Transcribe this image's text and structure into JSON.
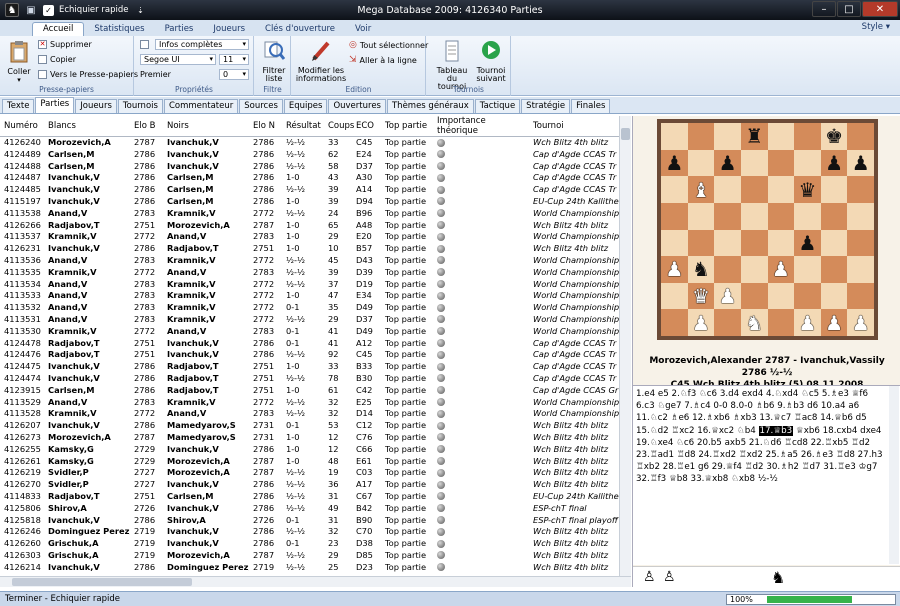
{
  "window": {
    "title": "Mega Database 2009:  4126340 Parties",
    "quick_access_label": "Echiquier rapide",
    "controls": [
      "–",
      "□",
      "✕"
    ]
  },
  "ribbon_tabs": [
    "Accueil",
    "Statistiques",
    "Parties",
    "Joueurs",
    "Clés d'ouverture",
    "Voir"
  ],
  "style_menu": "Style",
  "ribbon": {
    "clipboard": {
      "coller": "Coller",
      "supprimer": "Supprimer",
      "copier": "Copier",
      "vers": "Vers le Presse-papiers",
      "label": "Presse-papiers"
    },
    "props": {
      "infos": "Infos complètes",
      "font": "Segoe UI",
      "size": "11",
      "premier": "Premier",
      "premier_val": "0",
      "label": "Propriétés"
    },
    "filtre": {
      "btn1": "Filtrer",
      "btn2": "liste",
      "label": "Filtre"
    },
    "edition": {
      "modifier1": "Modifier les",
      "modifier2": "informations",
      "tout": "Tout sélectionner",
      "aller": "Aller à la ligne",
      "label": "Edition"
    },
    "tournois": {
      "tableau1": "Tableau",
      "tableau2": "du tournoi",
      "suivant1": "Tournoi",
      "suivant2": "suivant",
      "label": "Tournois"
    }
  },
  "doc_tabs": [
    "Texte",
    "Parties",
    "Joueurs",
    "Tournois",
    "Commentateur",
    "Sources",
    "Equipes",
    "Ouvertures",
    "Thèmes généraux",
    "Tactique",
    "Stratégie",
    "Finales"
  ],
  "columns": [
    "Numéro",
    "Blancs",
    "Elo B",
    "Noirs",
    "Elo N",
    "Résultat",
    "Coups",
    "ECO",
    "Top partie",
    "Importance théorique",
    "Tournoi"
  ],
  "rows": [
    [
      "4126240",
      "Morozevich,A",
      "2787",
      "Ivanchuk,V",
      "2786",
      "½-½",
      "33",
      "C45",
      "Top partie",
      "Wch Blitz 4th blitz"
    ],
    [
      "4124489",
      "Carlsen,M",
      "2786",
      "Ivanchuk,V",
      "2786",
      "½-½",
      "62",
      "E24",
      "Top partie",
      "Cap d'Agde CCAS Tr"
    ],
    [
      "4124488",
      "Carlsen,M",
      "2786",
      "Ivanchuk,V",
      "2786",
      "½-½",
      "58",
      "D37",
      "Top partie",
      "Cap d'Agde CCAS Tr"
    ],
    [
      "4124487",
      "Ivanchuk,V",
      "2786",
      "Carlsen,M",
      "2786",
      "1-0",
      "43",
      "A30",
      "Top partie",
      "Cap d'Agde CCAS Tr"
    ],
    [
      "4124485",
      "Ivanchuk,V",
      "2786",
      "Carlsen,M",
      "2786",
      "½-½",
      "39",
      "A14",
      "Top partie",
      "Cap d'Agde CCAS Tr"
    ],
    [
      "4115197",
      "Ivanchuk,V",
      "2786",
      "Carlsen,M",
      "2786",
      "1-0",
      "39",
      "D94",
      "Top partie",
      "EU-Cup 24th Kallithe"
    ],
    [
      "4113538",
      "Anand,V",
      "2783",
      "Kramnik,V",
      "2772",
      "½-½",
      "24",
      "B96",
      "Top partie",
      "World Championship"
    ],
    [
      "4126266",
      "Radjabov,T",
      "2751",
      "Morozevich,A",
      "2787",
      "1-0",
      "65",
      "A48",
      "Top partie",
      "Wch Blitz 4th blitz"
    ],
    [
      "4113537",
      "Kramnik,V",
      "2772",
      "Anand,V",
      "2783",
      "1-0",
      "29",
      "E20",
      "Top partie",
      "World Championship"
    ],
    [
      "4126231",
      "Ivanchuk,V",
      "2786",
      "Radjabov,T",
      "2751",
      "1-0",
      "10",
      "B57",
      "Top partie",
      "Wch Blitz 4th blitz"
    ],
    [
      "4113536",
      "Anand,V",
      "2783",
      "Kramnik,V",
      "2772",
      "½-½",
      "45",
      "D43",
      "Top partie",
      "World Championship"
    ],
    [
      "4113535",
      "Kramnik,V",
      "2772",
      "Anand,V",
      "2783",
      "½-½",
      "39",
      "D39",
      "Top partie",
      "World Championship"
    ],
    [
      "4113534",
      "Anand,V",
      "2783",
      "Kramnik,V",
      "2772",
      "½-½",
      "37",
      "D19",
      "Top partie",
      "World Championship"
    ],
    [
      "4113533",
      "Anand,V",
      "2783",
      "Kramnik,V",
      "2772",
      "1-0",
      "47",
      "E34",
      "Top partie",
      "World Championship"
    ],
    [
      "4113532",
      "Anand,V",
      "2783",
      "Kramnik,V",
      "2772",
      "0-1",
      "35",
      "D49",
      "Top partie",
      "World Championship"
    ],
    [
      "4113531",
      "Anand,V",
      "2783",
      "Kramnik,V",
      "2772",
      "½-½",
      "29",
      "D37",
      "Top partie",
      "World Championship"
    ],
    [
      "4113530",
      "Kramnik,V",
      "2772",
      "Anand,V",
      "2783",
      "0-1",
      "41",
      "D49",
      "Top partie",
      "World Championship"
    ],
    [
      "4124478",
      "Radjabov,T",
      "2751",
      "Ivanchuk,V",
      "2786",
      "0-1",
      "41",
      "A12",
      "Top partie",
      "Cap d'Agde CCAS Tr"
    ],
    [
      "4124476",
      "Radjabov,T",
      "2751",
      "Ivanchuk,V",
      "2786",
      "½-½",
      "92",
      "C45",
      "Top partie",
      "Cap d'Agde CCAS Tr"
    ],
    [
      "4124475",
      "Ivanchuk,V",
      "2786",
      "Radjabov,T",
      "2751",
      "1-0",
      "33",
      "B33",
      "Top partie",
      "Cap d'Agde CCAS Tr"
    ],
    [
      "4124474",
      "Ivanchuk,V",
      "2786",
      "Radjabov,T",
      "2751",
      "½-½",
      "78",
      "B30",
      "Top partie",
      "Cap d'Agde CCAS Tr"
    ],
    [
      "4123915",
      "Carlsen,M",
      "2786",
      "Radjabov,T",
      "2751",
      "1-0",
      "61",
      "C42",
      "Top partie",
      "Cap d'Agde CCAS Gr"
    ],
    [
      "4113529",
      "Anand,V",
      "2783",
      "Kramnik,V",
      "2772",
      "½-½",
      "32",
      "E25",
      "Top partie",
      "World Championship"
    ],
    [
      "4113528",
      "Kramnik,V",
      "2772",
      "Anand,V",
      "2783",
      "½-½",
      "32",
      "D14",
      "Top partie",
      "World Championship"
    ],
    [
      "4126207",
      "Ivanchuk,V",
      "2786",
      "Mamedyarov,S",
      "2731",
      "0-1",
      "53",
      "C12",
      "Top partie",
      "Wch Blitz 4th blitz"
    ],
    [
      "4126273",
      "Morozevich,A",
      "2787",
      "Mamedyarov,S",
      "2731",
      "1-0",
      "12",
      "C76",
      "Top partie",
      "Wch Blitz 4th blitz"
    ],
    [
      "4126255",
      "Kamsky,G",
      "2729",
      "Ivanchuk,V",
      "2786",
      "1-0",
      "12",
      "C66",
      "Top partie",
      "Wch Blitz 4th blitz"
    ],
    [
      "4126261",
      "Kamsky,G",
      "2729",
      "Morozevich,A",
      "2787",
      "1-0",
      "48",
      "E61",
      "Top partie",
      "Wch Blitz 4th blitz"
    ],
    [
      "4126219",
      "Svidler,P",
      "2727",
      "Morozevich,A",
      "2787",
      "½-½",
      "19",
      "C03",
      "Top partie",
      "Wch Blitz 4th blitz"
    ],
    [
      "4126270",
      "Svidler,P",
      "2727",
      "Ivanchuk,V",
      "2786",
      "½-½",
      "36",
      "A17",
      "Top partie",
      "Wch Blitz 4th blitz"
    ],
    [
      "4114833",
      "Radjabov,T",
      "2751",
      "Carlsen,M",
      "2786",
      "½-½",
      "31",
      "C67",
      "Top partie",
      "EU-Cup 24th Kallithe"
    ],
    [
      "4125806",
      "Shirov,A",
      "2726",
      "Ivanchuk,V",
      "2786",
      "½-½",
      "49",
      "B42",
      "Top partie",
      "ESP-chT final"
    ],
    [
      "4125818",
      "Ivanchuk,V",
      "2786",
      "Shirov,A",
      "2726",
      "0-1",
      "31",
      "B90",
      "Top partie",
      "ESP-chT final playoff"
    ],
    [
      "4126246",
      "Dominguez Perez,L",
      "2719",
      "Ivanchuk,V",
      "2786",
      "½-½",
      "32",
      "C70",
      "Top partie",
      "Wch Blitz 4th blitz"
    ],
    [
      "4126260",
      "Grischuk,A",
      "2719",
      "Ivanchuk,V",
      "2786",
      "0-1",
      "23",
      "D38",
      "Top partie",
      "Wch Blitz 4th blitz"
    ],
    [
      "4126303",
      "Grischuk,A",
      "2719",
      "Morozevich,A",
      "2787",
      "½-½",
      "29",
      "D85",
      "Top partie",
      "Wch Blitz 4th blitz"
    ],
    [
      "4126214",
      "Ivanchuk,V",
      "2786",
      "Dominguez Perez,L",
      "2719",
      "½-½",
      "25",
      "D23",
      "Top partie",
      "Wch Blitz 4th blitz"
    ]
  ],
  "game": {
    "header1": "Morozevich,Alexander 2787 - Ivanchuk,Vassily 2786  ½-½",
    "header2": "C45  Wch Blitz 4th blitz (5) 08.11.2008",
    "moves_before": "1.e4  e5  2.♘f3  ♘c6  3.d4  exd4  4.♘xd4  ♘c5  5.♗e3  ♕f6  6.c3  ♘ge7  7.♗c4  0-0  8.0-0  ♗b6  9.♗b3  d6  10.a4  a6  11.♘c2  ♗e6  12.♗xb6  ♗xb3  13.♕c7  ♖ac8  14.♕b6  d5  15.♘d2  ♖xc2  16.♕xc2  ♘b4  ",
    "moves_current": "17.♕b3",
    "moves_after": "  ♕xb6  18.cxb4  dxe4  19.♘xe4  ♘c6  20.b5  axb5  21.♘d6  ♖cd8  22.♖xb5  ♖d2  23.♖ad1  ♖d8  24.♖xd2  ♖xd2  25.♗a5  26.♗e3  ♖d8  27.h3  ♖xb2  28.♖e1  g6  29.♕f4  ♖d2  30.♗h2  ♖d7  31.♖e3  ♔g7  32.♖f3  ♕b8  33.♕xb8  ♘xb8  ½-½"
  },
  "board": [
    [
      "",
      "",
      "",
      "r",
      "",
      "",
      "k",
      ""
    ],
    [
      "",
      "p",
      "",
      "",
      "",
      "p",
      "",
      "p"
    ],
    [
      "",
      "",
      "p",
      "",
      "p",
      "",
      "",
      ""
    ],
    [
      "",
      "B",
      "",
      "",
      "",
      "q",
      "",
      ""
    ],
    [
      "",
      "",
      "",
      "",
      "",
      "P",
      "",
      ""
    ],
    [
      "P",
      "n",
      "",
      "",
      "p",
      "P",
      "",
      ""
    ],
    [
      "",
      "Q",
      "P",
      "",
      "",
      "",
      "",
      ""
    ],
    [
      "",
      "P",
      "",
      "N",
      "",
      "P",
      "P",
      "P"
    ]
  ],
  "board_display": [
    [
      "",
      "",
      "",
      "r",
      "",
      "",
      "k",
      ""
    ],
    [
      "p",
      "",
      "p",
      "",
      "",
      "",
      "p",
      "p"
    ],
    [
      "",
      "B",
      "",
      "",
      "",
      "q",
      "",
      ""
    ],
    [
      "",
      "",
      "",
      "",
      "",
      "",
      "",
      ""
    ],
    [
      "",
      "",
      "",
      "",
      "",
      "p",
      "",
      ""
    ],
    [
      "P",
      "n",
      "",
      "",
      "P",
      "",
      "",
      ""
    ],
    [
      "",
      "Q",
      "P",
      "",
      "",
      "",
      "",
      ""
    ],
    [
      "",
      "P",
      "",
      "N",
      "",
      "P",
      "P",
      "P"
    ]
  ],
  "status": {
    "left": "Terminer - Echiquier rapide",
    "progress": "100%",
    "progress_value": 1.0
  }
}
